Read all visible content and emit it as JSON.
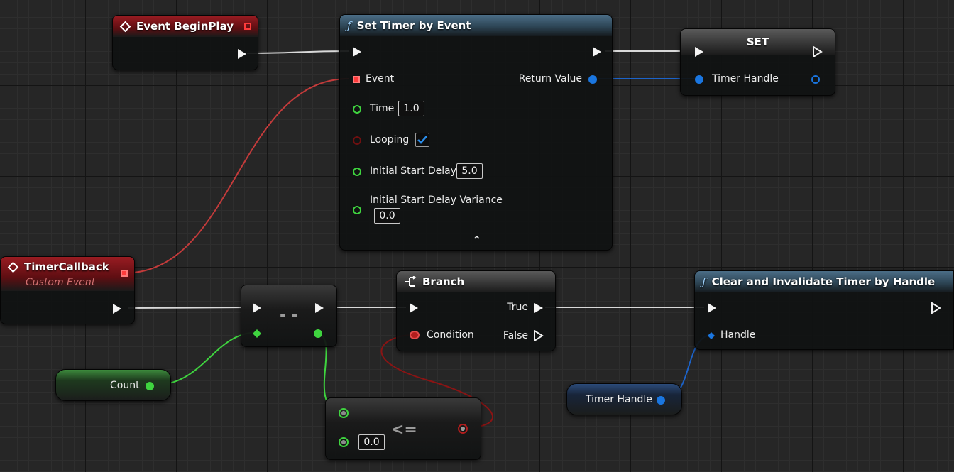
{
  "nodes": {
    "begin_play": {
      "title": "Event BeginPlay"
    },
    "set_timer": {
      "title": "Set Timer by Event",
      "event_label": "Event",
      "return_label": "Return Value",
      "time_label": "Time",
      "time_value": "1.0",
      "looping_label": "Looping",
      "looping_checked": true,
      "start_delay_label": "Initial Start Delay",
      "start_delay_value": "5.0",
      "variance_label": "Initial Start Delay Variance",
      "variance_value": "0.0",
      "collapse_glyph": "⌃"
    },
    "set_var": {
      "title": "SET",
      "pin_label": "Timer Handle"
    },
    "timer_callback": {
      "title": "TimerCallback",
      "subtitle": "Custom Event"
    },
    "decrement": {
      "op": "- -"
    },
    "branch": {
      "title": "Branch",
      "true_label": "True",
      "false_label": "False",
      "condition_label": "Condition"
    },
    "clear_timer": {
      "title": "Clear and Invalidate Timer by Handle",
      "handle_label": "Handle"
    },
    "count_var": {
      "label": "Count"
    },
    "timer_handle_var": {
      "label": "Timer Handle"
    },
    "compare": {
      "op": "<=",
      "value": "0.0"
    }
  },
  "colors": {
    "exec_wire": "#d9d9d9",
    "delegate_wire": "#c33b3b",
    "struct_wire": "#1c63c9",
    "int_wire": "#3fd43f",
    "bool_wire": "#8a1414"
  }
}
